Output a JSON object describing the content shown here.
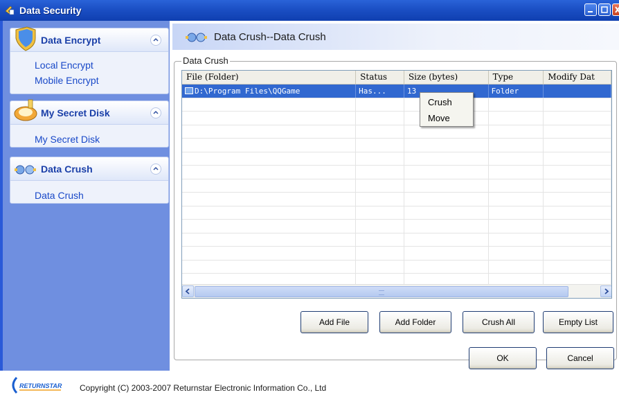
{
  "window": {
    "title": "Data Security",
    "buttons": [
      "minimize",
      "maximize",
      "close"
    ]
  },
  "sidebar": {
    "groups": [
      {
        "label": "Data Encrypt",
        "icon": "shield-icon",
        "items": [
          "Local Encrypt",
          "Mobile Encrypt"
        ]
      },
      {
        "label": "My Secret Disk",
        "icon": "disk-icon",
        "items": [
          "My Secret Disk"
        ]
      },
      {
        "label": "Data Crush",
        "icon": "crush-icon",
        "items": [
          "Data Crush"
        ]
      }
    ],
    "collapse_glyph": "⌃"
  },
  "main": {
    "header_title": "Data Crush--Data Crush",
    "section_label": "Data Crush",
    "columns": [
      "File (Folder)",
      "Status",
      "Size (bytes)",
      "Type",
      "Modify Dat"
    ],
    "rows": [
      {
        "file": "D:\\Program Files\\QQGame",
        "status": "Has...",
        "size": "13",
        "type": "Folder",
        "modified": ""
      }
    ],
    "context_menu": [
      "Crush",
      "Move"
    ],
    "buttons": {
      "add_file": "Add File",
      "add_folder": "Add Folder",
      "crush_all": "Crush All",
      "empty_list": "Empty List"
    }
  },
  "dialog_buttons": {
    "ok": "OK",
    "cancel": "Cancel"
  },
  "footer": {
    "logo_text": "RETURNSTAR",
    "copyright": "Copyright (C) 2003-2007 Returnstar Electronic Information Co., Ltd"
  },
  "colors": {
    "titlebar": "#1b4fc4",
    "sidebar": "#6f8fe0",
    "selection": "#3168d0",
    "link": "#1848c8"
  }
}
